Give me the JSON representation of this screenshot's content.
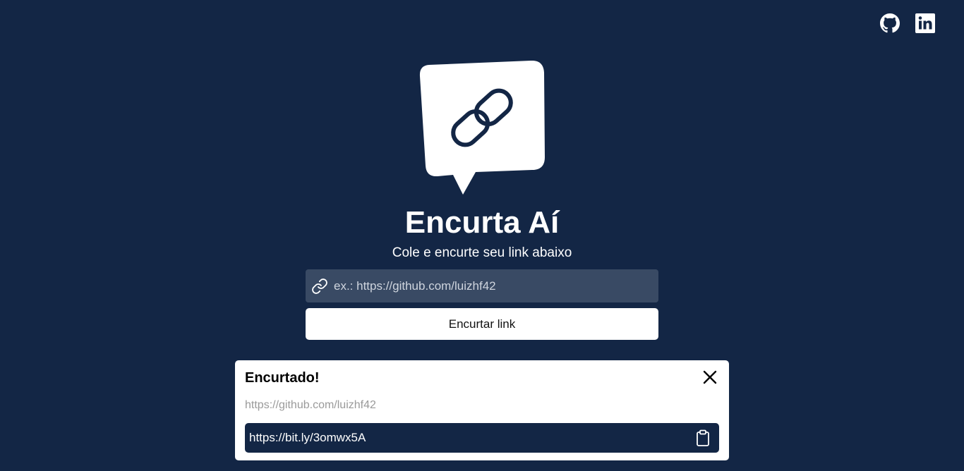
{
  "social": {
    "github_icon": "github-icon",
    "linkedin_icon": "linkedin-icon"
  },
  "hero": {
    "logo_icon": "chain-link-icon",
    "title": "Encurta Aí",
    "subtitle": "Cole e encurte seu link abaixo"
  },
  "form": {
    "input_icon": "link-icon",
    "placeholder": "ex.: https://github.com/luizhf42",
    "value": "",
    "button_label": "Encurtar link"
  },
  "result": {
    "title": "Encurtado!",
    "original_url": "https://github.com/luizhf42",
    "short_url": "https://bit.ly/3omwx5A",
    "close_icon": "close-icon",
    "copy_icon": "clipboard-icon"
  },
  "colors": {
    "background": "#132645",
    "input_background": "#394a64",
    "card": "#ffffff",
    "muted_text": "#9a9a9a"
  }
}
